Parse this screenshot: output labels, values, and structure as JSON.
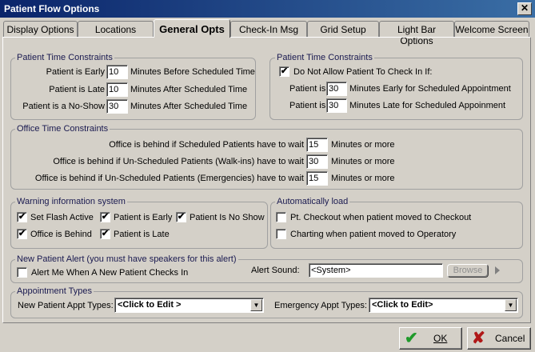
{
  "window": {
    "title": "Patient Flow Options",
    "close_glyph": "✕"
  },
  "tabs": [
    {
      "label": "Display Options"
    },
    {
      "label": "Locations"
    },
    {
      "label": "General Opts"
    },
    {
      "label": "Check-In Msg"
    },
    {
      "label": "Grid Setup"
    },
    {
      "label": "Light Bar Options"
    },
    {
      "label": "Welcome Screen"
    }
  ],
  "patient_time": {
    "legend": "Patient Time Constraints",
    "rows": [
      {
        "label": "Patient is Early",
        "value": "10",
        "suffix": "Minutes Before Scheduled Time"
      },
      {
        "label": "Patient is Late",
        "value": "10",
        "suffix": "Minutes After Scheduled Time"
      },
      {
        "label": "Patient is a No-Show",
        "value": "30",
        "suffix": "Minutes After Scheduled Time"
      }
    ]
  },
  "checkin_constraints": {
    "legend": "Patient Time Constraints",
    "checkbox_label": "Do Not Allow Patient To Check In If:",
    "checked": true,
    "rows": [
      {
        "label": "Patient is",
        "value": "30",
        "suffix": "Minutes Early for Scheduled Appointment"
      },
      {
        "label": "Patient is",
        "value": "30",
        "suffix": "Minutes Late for Scheduled Appoinment"
      }
    ]
  },
  "office_time": {
    "legend": "Office Time Constraints",
    "rows": [
      {
        "label": "Office is behind if Scheduled Patients have to wait",
        "value": "15",
        "suffix": "Minutes or more"
      },
      {
        "label": "Office is behind if Un-Scheduled Patients (Walk-ins) have to wait",
        "value": "30",
        "suffix": "Minutes or more"
      },
      {
        "label": "Office is behind if Un-Scheduled Patients (Emergencies) have to wait",
        "value": "15",
        "suffix": "Minutes or more"
      }
    ]
  },
  "warning": {
    "legend": "Warning information system",
    "items": [
      {
        "label": "Set Flash Active",
        "checked": true
      },
      {
        "label": "Patient is Early",
        "checked": true
      },
      {
        "label": "Patient Is No Show",
        "checked": true
      },
      {
        "label": "Office is Behind",
        "checked": true
      },
      {
        "label": "Patient is Late",
        "checked": true
      }
    ]
  },
  "autoload": {
    "legend": "Automatically load",
    "items": [
      {
        "label": "Pt. Checkout when patient moved to Checkout",
        "checked": false
      },
      {
        "label": "Charting when patient moved to Operatory",
        "checked": false
      }
    ]
  },
  "alert": {
    "legend": "New Patient Alert (you must have speakers for this alert)",
    "checkbox_label": "Alert Me When A New Patient Checks In",
    "checked": false,
    "sound_label": "Alert Sound:",
    "sound_value": "<System>",
    "browse_label": "Browse"
  },
  "appt_types": {
    "legend": "Appointment Types",
    "new_label": "New Patient Appt Types:",
    "new_value": "<Click to Edit >",
    "emergency_label": "Emergency Appt Types:",
    "emergency_value": "<Click to Edit>"
  },
  "buttons": {
    "ok": "OK",
    "cancel": "Cancel"
  }
}
